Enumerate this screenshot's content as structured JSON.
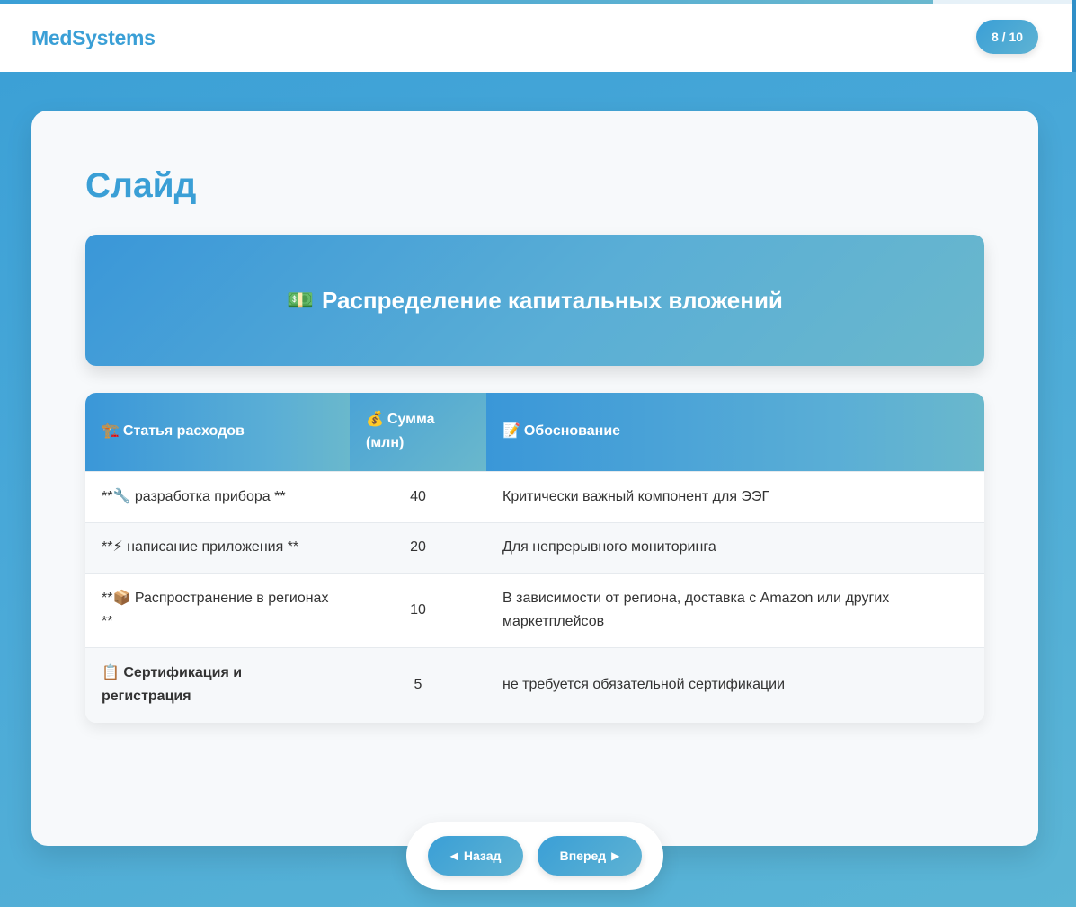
{
  "header": {
    "brand": "MedSystems",
    "counter": "8 / 10",
    "progress": 0.867
  },
  "slide": {
    "title": "Слайд",
    "banner_icon": "💵",
    "banner_title": "Распределение капитальных вложений"
  },
  "table": {
    "headers": [
      {
        "icon": "🏗️",
        "label": "Статья расходов"
      },
      {
        "icon": "💰",
        "label": "Сумма (млн)"
      },
      {
        "icon": "📝",
        "label": "Обоснование"
      }
    ],
    "rows": [
      {
        "item": "**🔧 разработка прибора **",
        "amount": "40",
        "reason": "Критически важный компонент для ЭЭГ"
      },
      {
        "item": "**⚡ написание приложения **",
        "amount": "20",
        "reason": "Для непрерывного мониторинга"
      },
      {
        "item": "**📦 Распространение в регионах **",
        "amount": "10",
        "reason": "В зависимости от региона, доставка с Amazon или других маркетплейсов"
      },
      {
        "item": "📋 Сертификация и регистрация",
        "amount": "5",
        "reason": "не требуется обязательной сертификации"
      }
    ]
  },
  "nav": {
    "back_label": "Назад",
    "next_label": "Вперед",
    "back_icon": "triangle-left-icon",
    "next_icon": "triangle-right-icon"
  }
}
